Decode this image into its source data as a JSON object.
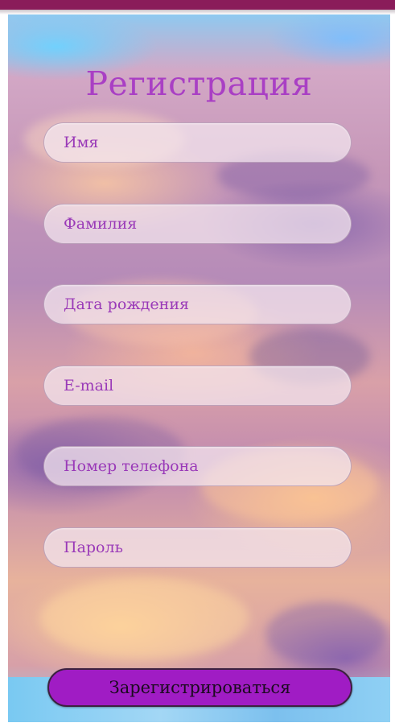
{
  "form": {
    "title": "Регистрация",
    "fields": [
      {
        "placeholder": "Имя",
        "value": ""
      },
      {
        "placeholder": "Фамилия",
        "value": ""
      },
      {
        "placeholder": "Дата рождения",
        "value": ""
      },
      {
        "placeholder": "E-mail",
        "value": ""
      },
      {
        "placeholder": "Номер телефона",
        "value": ""
      },
      {
        "placeholder": "Пароль",
        "value": ""
      }
    ],
    "submit_label": "Зарегистрироваться"
  },
  "colors": {
    "top_bar": "#8a1c5a",
    "title_text": "#a93fc4",
    "field_text": "#9a3ab8",
    "button_background": "#a01cc4",
    "button_text": "#1c0a20"
  },
  "background": "sunset-clouds-image"
}
